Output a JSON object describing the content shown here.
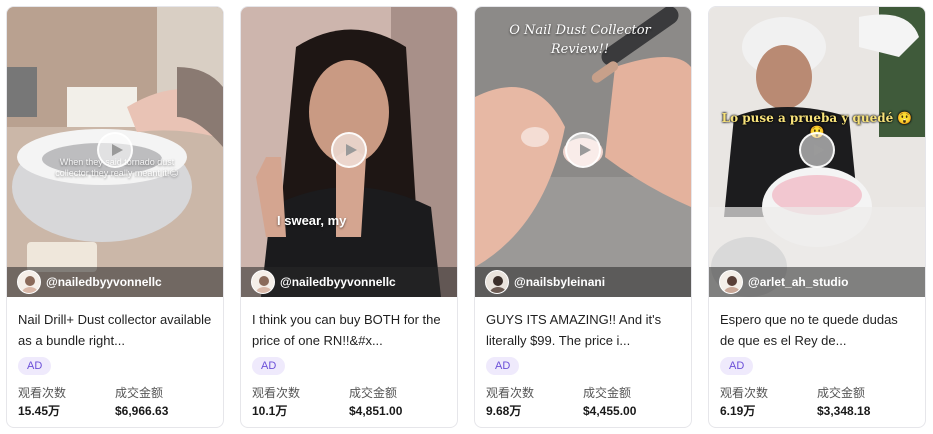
{
  "cards": [
    {
      "handle": "@nailedbyyvonnellc",
      "description": "Nail Drill+ Dust collector available as a bundle right...",
      "overlay_text": "When they said tornado dust collector they really meant it!😊",
      "badge": "AD",
      "views_label": "观看次数",
      "views": "15.45万",
      "gmv_label": "成交金额",
      "gmv": "$6,966.63"
    },
    {
      "handle": "@nailedbyyvonnellc",
      "description": "I think you can buy BOTH for the price of one RN!!&#x...",
      "overlay_text": "I swear, my",
      "badge": "AD",
      "views_label": "观看次数",
      "views": "10.1万",
      "gmv_label": "成交金额",
      "gmv": "$4,851.00"
    },
    {
      "handle": "@nailsbyleinani",
      "description": "GUYS ITS AMAZING!! And it's literally $99. The price i...",
      "overlay_text": "O Nail Dust Collector Review!!",
      "badge": "AD",
      "views_label": "观看次数",
      "views": "9.68万",
      "gmv_label": "成交金额",
      "gmv": "$4,455.00"
    },
    {
      "handle": "@arlet_ah_studio",
      "description": "Espero que no te quede dudas de que es el Rey de...",
      "overlay_text": "Lo puse a prueba y quedé 😲😲",
      "badge": "AD",
      "views_label": "观看次数",
      "views": "6.19万",
      "gmv_label": "成交金额",
      "gmv": "$3,348.18"
    }
  ]
}
